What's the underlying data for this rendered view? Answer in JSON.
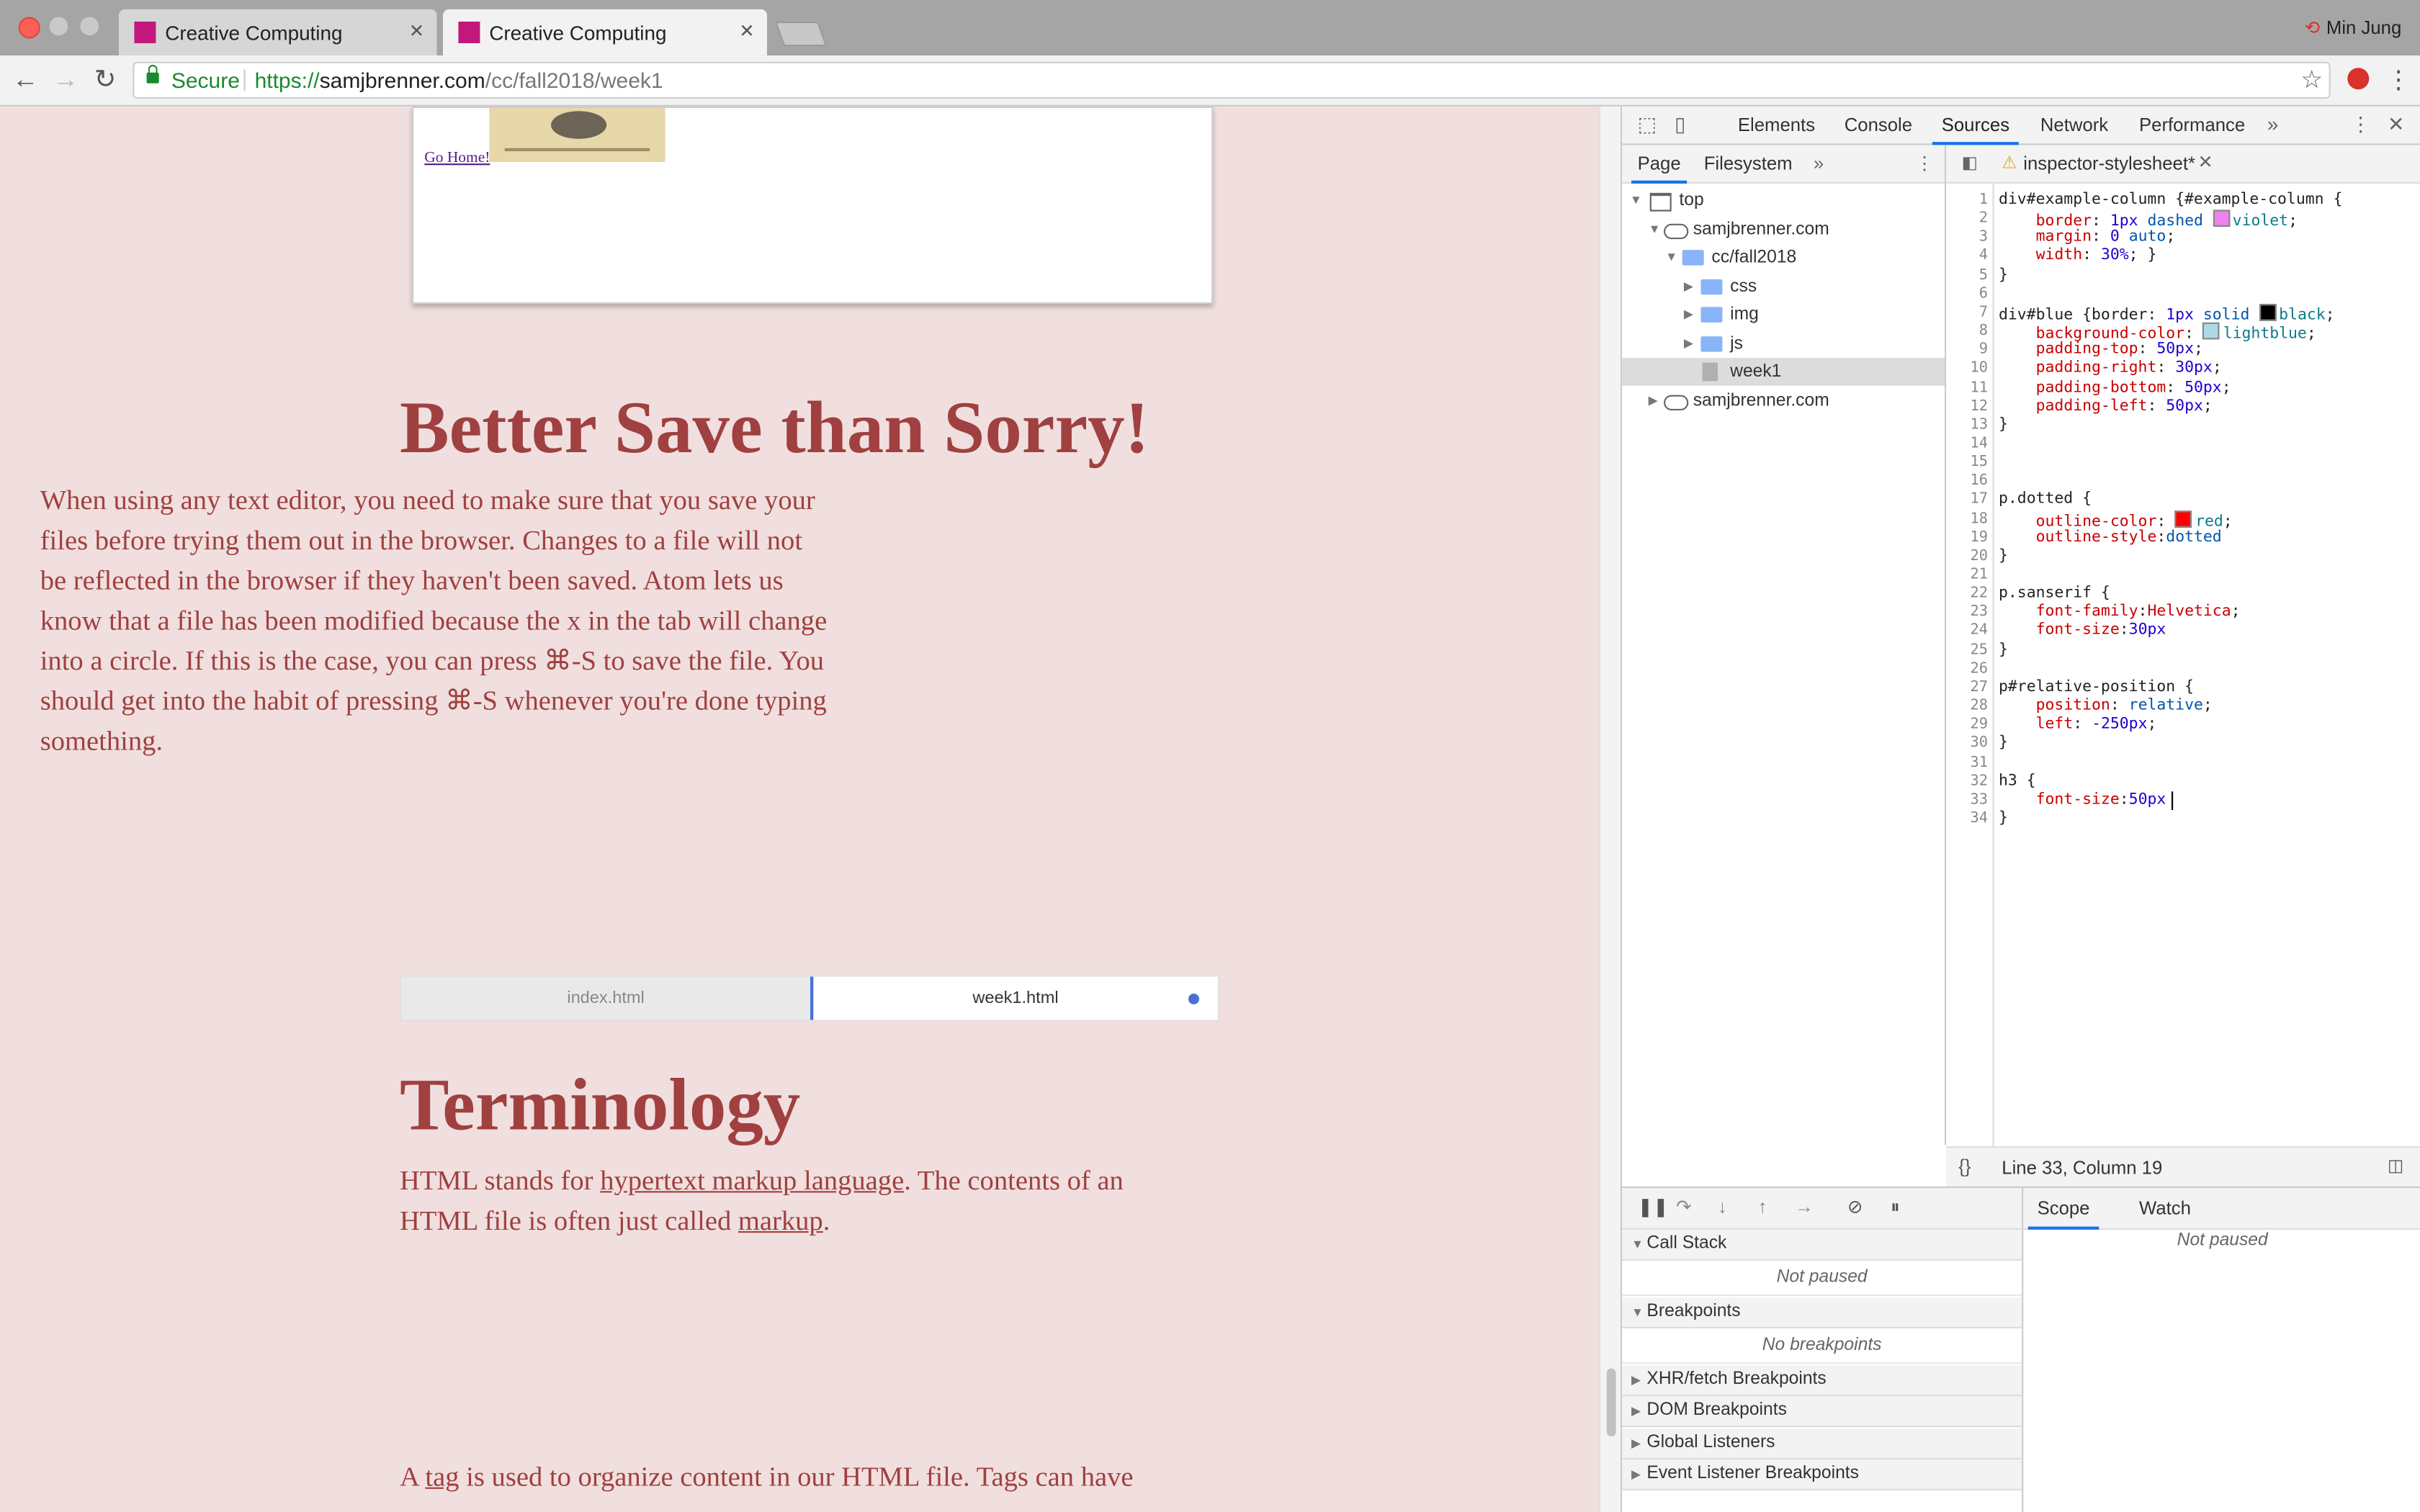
{
  "browser": {
    "tabs": [
      {
        "title": "Creative Computing",
        "active": false
      },
      {
        "title": "Creative Computing",
        "active": true
      }
    ],
    "profile_name": "Min Jung",
    "secure_label": "Secure",
    "url": {
      "scheme": "https://",
      "host": "samjbrenner.com",
      "path": "/cc/fall2018/week1"
    },
    "colors": {
      "favicon": "#c2187e",
      "secure": "#1a8a2e"
    }
  },
  "page": {
    "go_home": "Go Home!",
    "section1": {
      "heading": "Better Save than Sorry!",
      "paragraph_lines": [
        "When using any text editor, you need to make sure that you save your",
        "files before trying them out in the browser. Changes to a file will not",
        "be reflected in the browser if they haven't been saved. Atom lets us",
        "know that a file has been modified because the x in the tab will change",
        "into a circle. If this is the case, you can press ⌘-S to save the file. You",
        "should get into the habit of pressing ⌘-S whenever you're done typing",
        "something."
      ]
    },
    "atom_tabs": [
      "index.html",
      "week1.html"
    ],
    "section2": {
      "heading": "Terminology",
      "line1_pre": "HTML stands for ",
      "line1_link": "hypertext markup language",
      "line1_post": ". The contents of an",
      "line2_pre": "HTML file is often just called ",
      "line2_link": "markup",
      "line2_post": ".",
      "line3_pre": "A ",
      "line3_link": "tag",
      "line3_post": " is used to organize content in our HTML file. Tags can have"
    },
    "colors": {
      "background": "#f0dfde",
      "text": "#a04040"
    }
  },
  "devtools": {
    "tabs": [
      "Elements",
      "Console",
      "Sources",
      "Network",
      "Performance"
    ],
    "active_tab": "Sources",
    "navigator_tabs": [
      "Page",
      "Filesystem"
    ],
    "tree": [
      {
        "label": "top",
        "level": 0,
        "icon": "window"
      },
      {
        "label": "samjbrenner.com",
        "level": 1,
        "icon": "cloud"
      },
      {
        "label": "cc/fall2018",
        "level": 2,
        "icon": "folder"
      },
      {
        "label": "css",
        "level": 3,
        "icon": "folder"
      },
      {
        "label": "img",
        "level": 3,
        "icon": "folder"
      },
      {
        "label": "js",
        "level": 3,
        "icon": "folder"
      },
      {
        "label": "week1",
        "level": 3,
        "icon": "file",
        "selected": true
      },
      {
        "label": "samjbrenner.com",
        "level": 1,
        "icon": "cloud"
      }
    ],
    "editor_tab": "inspector-stylesheet*",
    "status": "Line 33, Column 19",
    "code_lines": [
      "div#example-column {#example-column {",
      "    border: 1px dashed  violet;",
      "    margin: 0 auto;",
      "    width: 30%; }",
      "}",
      "",
      "div#blue {border: 1px solid  black;",
      "    background-color:  lightblue;",
      "    padding-top: 50px;",
      "    padding-right: 30px;",
      "    padding-bottom: 50px;",
      "    padding-left: 50px;",
      "}",
      "",
      "",
      "",
      "p.dotted {",
      "    outline-color: red;",
      "    outline-style:dotted",
      "}",
      "",
      "p.sanserif {",
      "    font-family:Helvetica;",
      "    font-size:30px",
      "}",
      "",
      "p#relative-position {",
      "    position: relative;",
      "    left: -250px;",
      "}",
      "",
      "h3 {",
      "    font-size:50px",
      "}"
    ],
    "swatches": {
      "violet": "#ee82ee",
      "black": "#000000",
      "lightblue": "#add8e6",
      "red": "#ff0000"
    },
    "debugger": {
      "sections": [
        "Call Stack",
        "Breakpoints",
        "XHR/fetch Breakpoints",
        "DOM Breakpoints",
        "Global Listeners",
        "Event Listener Breakpoints"
      ],
      "not_paused": "Not paused",
      "no_breakpoints": "No breakpoints",
      "right_tabs": [
        "Scope",
        "Watch"
      ]
    }
  }
}
